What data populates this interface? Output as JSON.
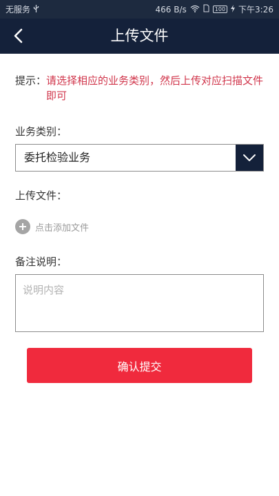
{
  "status_bar": {
    "carrier": "无服务",
    "net_speed": "466 B/s",
    "battery": "100",
    "time": "下午3:26"
  },
  "nav": {
    "title": "上传文件"
  },
  "hint": {
    "label": "提示：",
    "text": "请选择相应的业务类别，然后上传对应扫描文件即可"
  },
  "business_type": {
    "label": "业务类别：",
    "selected": "委托检验业务"
  },
  "upload": {
    "label": "上传文件：",
    "add_text": "点击添加文件"
  },
  "remark": {
    "label": "备注说明：",
    "placeholder": "说明内容",
    "value": ""
  },
  "submit": {
    "label": "确认提交"
  },
  "colors": {
    "nav_bg": "#14213a",
    "hint_red": "#d0344a",
    "button_red": "#f02a3d"
  }
}
